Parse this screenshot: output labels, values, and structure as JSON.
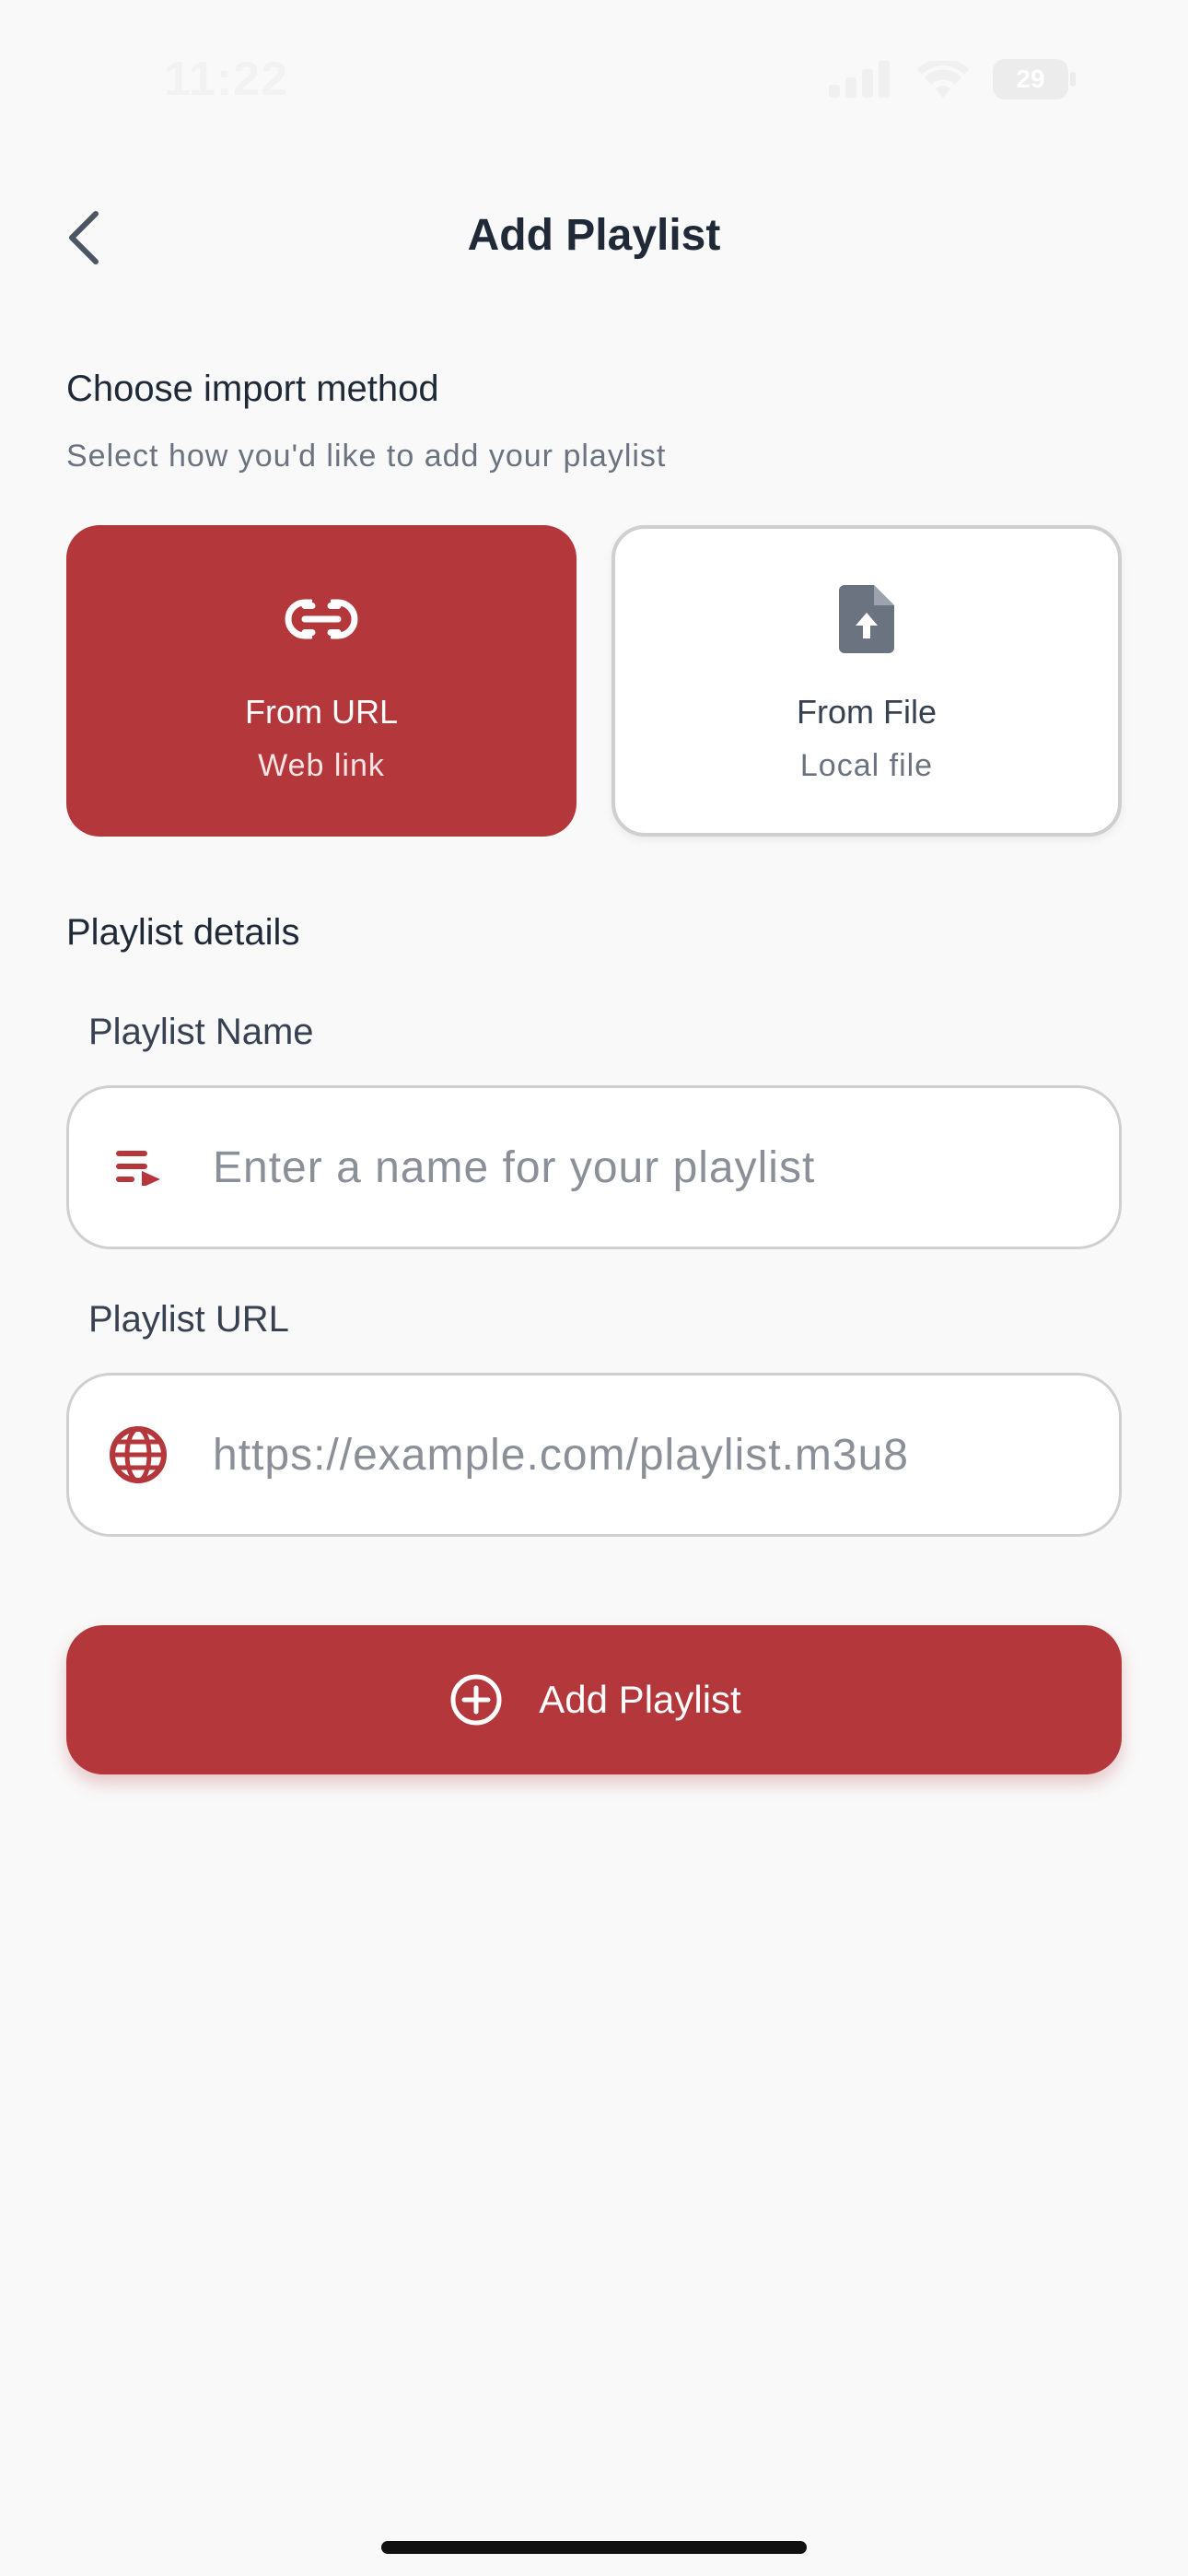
{
  "status_bar": {
    "time": "11:22",
    "battery": "29"
  },
  "header": {
    "title": "Add Playlist"
  },
  "import_section": {
    "title": "Choose import method",
    "subtitle": "Select how you'd like to add your playlist",
    "options": [
      {
        "label": "From URL",
        "sublabel": "Web link",
        "icon": "link-icon",
        "selected": true
      },
      {
        "label": "From File",
        "sublabel": "Local file",
        "icon": "file-upload-icon",
        "selected": false
      }
    ]
  },
  "details_section": {
    "title": "Playlist details",
    "name_field": {
      "label": "Playlist Name",
      "placeholder": "Enter a name for your playlist",
      "value": "",
      "icon": "playlist-icon"
    },
    "url_field": {
      "label": "Playlist URL",
      "placeholder": "https://example.com/playlist.m3u8",
      "value": "",
      "icon": "globe-icon"
    }
  },
  "submit": {
    "label": "Add Playlist",
    "icon": "add-circle-icon"
  },
  "colors": {
    "accent": "#b4373b",
    "background": "#f9f9f9",
    "text_primary": "#1f2937",
    "text_secondary": "#6b7280"
  }
}
